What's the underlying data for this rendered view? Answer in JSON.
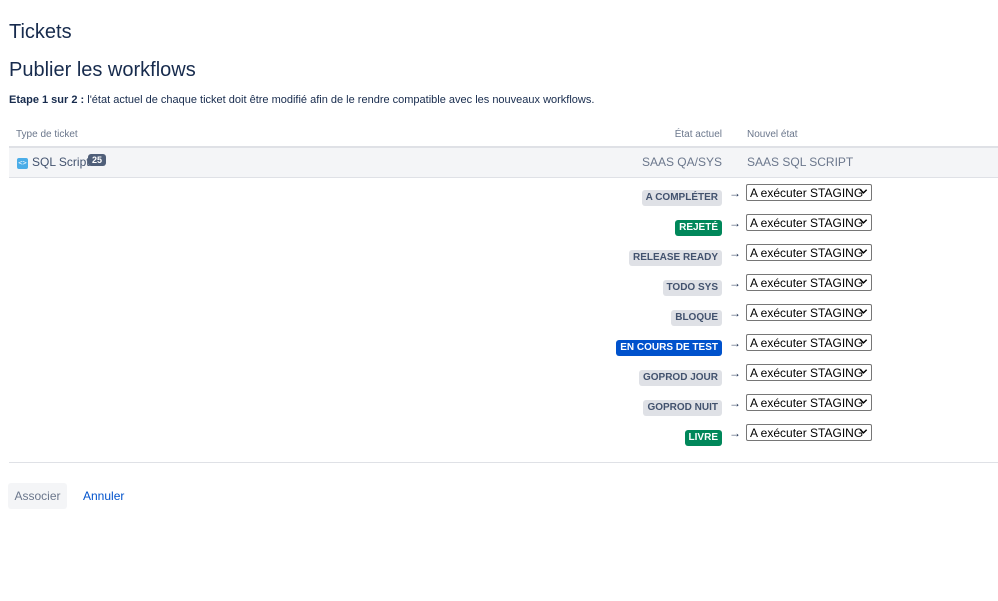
{
  "page": {
    "title": "Tickets",
    "subtitle": "Publier les workflows",
    "intro_step": "Etape 1 sur 2 :",
    "intro_text": " l'état actuel de chaque ticket doit être modifié afin de le rendre compatible avec les nouveaux workflows."
  },
  "table": {
    "col_type": "Type de ticket",
    "col_current": "État actuel",
    "col_new": "Nouvel état",
    "row": {
      "type_label": "SQL Script",
      "count": "25",
      "current_workflow": "SAAS QA/SYS",
      "new_workflow": "SAAS SQL SCRIPT"
    },
    "mappings": [
      {
        "status": "A COMPLÉTER",
        "style": "default",
        "target": "A exécuter STAGING"
      },
      {
        "status": "REJETÉ",
        "style": "green",
        "target": "A exécuter STAGING"
      },
      {
        "status": "RELEASE READY",
        "style": "default",
        "target": "A exécuter STAGING"
      },
      {
        "status": "TODO SYS",
        "style": "default",
        "target": "A exécuter STAGING"
      },
      {
        "status": "BLOQUE",
        "style": "default",
        "target": "A exécuter STAGING"
      },
      {
        "status": "EN COURS DE TEST",
        "style": "blue",
        "target": "A exécuter STAGING"
      },
      {
        "status": "GOPROD JOUR",
        "style": "default",
        "target": "A exécuter STAGING"
      },
      {
        "status": "GOPROD NUIT",
        "style": "default",
        "target": "A exécuter STAGING"
      },
      {
        "status": "LIVRE",
        "style": "green",
        "target": "A exécuter STAGING"
      }
    ],
    "arrow": "→"
  },
  "actions": {
    "submit_label": "Associer",
    "cancel_label": "Annuler"
  },
  "colors": {
    "green": "#00875a",
    "blue": "#0052cc",
    "default": "#dfe1e6"
  }
}
